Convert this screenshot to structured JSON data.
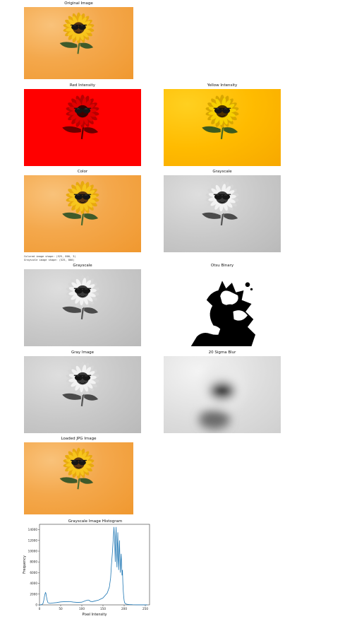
{
  "titles": {
    "original": "Original Image",
    "red": "Red Intensity",
    "yellow": "Yellow Intensity",
    "color": "Color",
    "grayscale1": "Grayscale",
    "grayscale2": "Grayscale",
    "otsu": "Otsu Binary",
    "gray_image": "Gray Image",
    "blur": "20 Sigma Blur",
    "loaded": "Loaded JPG Image"
  },
  "console_output": {
    "line1": "Colored image shape: (525, 800, 3)",
    "line2": "Grayscale image shape: (525, 800)"
  },
  "colors": {
    "orange_bg": "#f2a13e",
    "petal_yellow": "#f7c51d",
    "red_channel": "#ff0000",
    "yellow_channel": "#ffbb00",
    "leaf_green": "#3f5a2a",
    "histogram_line": "#1f77b4"
  },
  "chart_data": {
    "type": "line",
    "title": "Grayscale Image Histogram",
    "xlabel": "Pixel Intensity",
    "ylabel": "Frequency",
    "xlim": [
      0,
      260
    ],
    "ylim": [
      0,
      15000
    ],
    "xticks": [
      "0",
      "50",
      "100",
      "150",
      "200",
      "250"
    ],
    "yticks": [
      "0",
      "2000",
      "4000",
      "6000",
      "8000",
      "10000",
      "12000",
      "14000"
    ],
    "series": [
      {
        "x": [
          0,
          5,
          8,
          10,
          12,
          14,
          15,
          16,
          18,
          20,
          25,
          30,
          40,
          50,
          60,
          70,
          80,
          90,
          100,
          105,
          110,
          115,
          118,
          120,
          125,
          130,
          140,
          150,
          160,
          165,
          168,
          170,
          172,
          174,
          176,
          178,
          179,
          180,
          181,
          182,
          183,
          184,
          185,
          186,
          187,
          188,
          189,
          190,
          191,
          192,
          193,
          194,
          195,
          196,
          197,
          198,
          199,
          200,
          201,
          202,
          203,
          205,
          208,
          212,
          220,
          230,
          240,
          250,
          255
        ],
        "y": [
          0,
          50,
          200,
          800,
          1700,
          2300,
          2200,
          1700,
          900,
          400,
          280,
          350,
          420,
          550,
          600,
          620,
          520,
          450,
          500,
          650,
          800,
          900,
          820,
          650,
          600,
          700,
          900,
          1300,
          2200,
          3300,
          5000,
          7500,
          9500,
          12000,
          14500,
          11000,
          8000,
          12500,
          14500,
          10000,
          7000,
          11000,
          13500,
          9000,
          6500,
          9500,
          12000,
          8500,
          6000,
          8000,
          9500,
          7500,
          5500,
          6500,
          4000,
          2500,
          1500,
          800,
          450,
          300,
          220,
          150,
          100,
          60,
          30,
          10,
          5,
          5,
          0
        ]
      }
    ]
  }
}
